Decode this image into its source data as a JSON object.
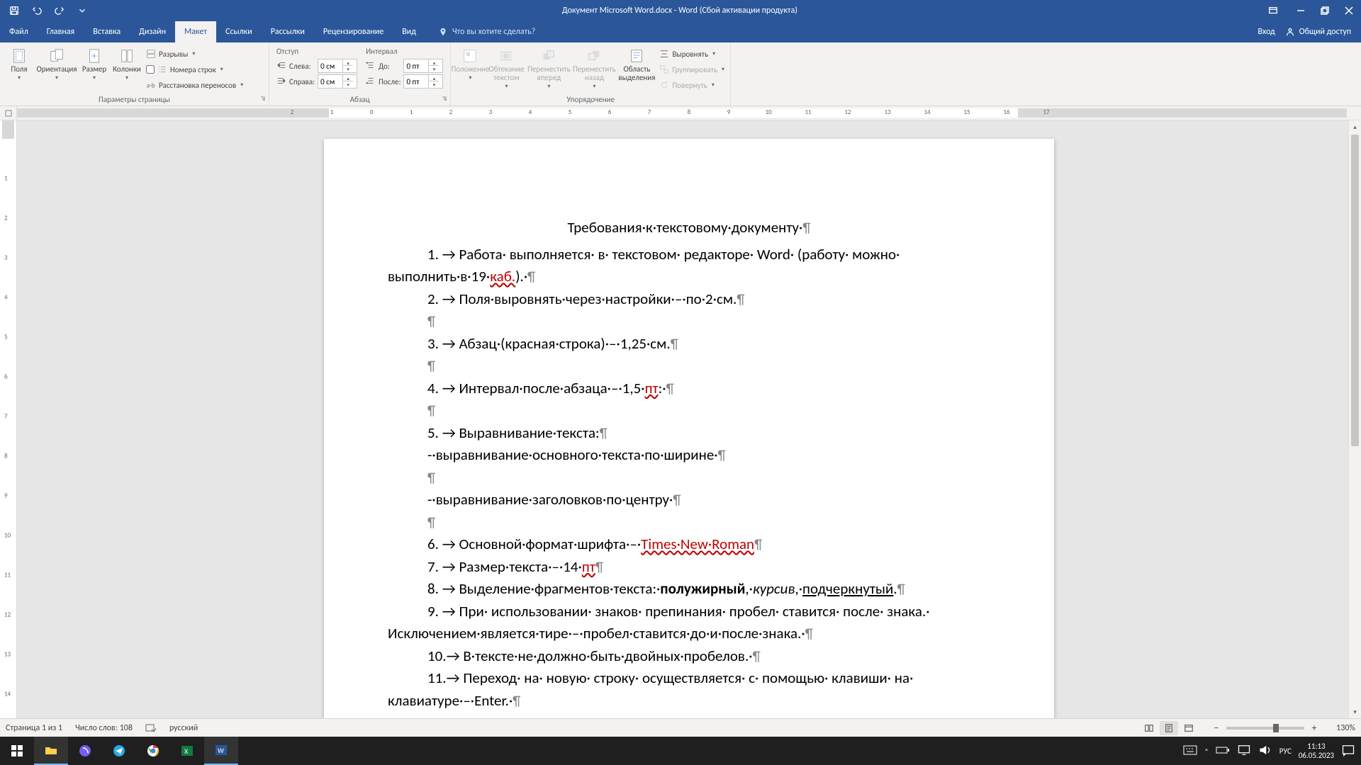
{
  "titlebar": {
    "title": "Документ Microsoft Word.docx - Word (Сбой активации продукта)"
  },
  "tabs": {
    "file": "Файл",
    "home": "Главная",
    "insert": "Вставка",
    "design": "Дизайн",
    "layout": "Макет",
    "references": "Ссылки",
    "mailings": "Рассылки",
    "review": "Рецензирование",
    "view": "Вид",
    "tell_me": "Что вы хотите сделать?",
    "signin": "Вход",
    "share": "Общий доступ"
  },
  "ribbon": {
    "page_setup": {
      "label": "Параметры страницы",
      "margins": "Поля",
      "orientation": "Ориентация",
      "size": "Размер",
      "columns": "Колонки",
      "breaks": "Разрывы",
      "line_numbers": "Номера строк",
      "hyphenation": "Расстановка переносов"
    },
    "paragraph": {
      "label": "Абзац",
      "indent_header": "Отступ",
      "left": "Слева:",
      "right": "Справа:",
      "left_val": "0 см",
      "right_val": "0 см",
      "spacing_header": "Интервал",
      "before": "До:",
      "after": "После:",
      "before_val": "0 пт",
      "after_val": "0 пт"
    },
    "arrange": {
      "label": "Упорядочение",
      "position": "Положение",
      "wrap": "Обтекание текстом",
      "forward": "Переместить вперед",
      "backward": "Переместить назад",
      "selection": "Область выделения",
      "align": "Выровнять",
      "group": "Группировать",
      "rotate": "Повернуть"
    }
  },
  "doc": {
    "title": "Требования·к·текстовому·документу·",
    "l1a": "1. → Работа· выполняется· в· текстовом· редакторе· Word· (работу· можно· ",
    "l1b": "выполнить·в·19·",
    "l1c": "каб.",
    "l1d": ").·",
    "l2": "2. → Поля·выровнять·через·настройки·–·по·2·см.",
    "l3": "3. → Абзац·(красная·строка)·–·1,25·см.",
    "l4a": "4. → Интервал·после·абзаца·–·1,5·",
    "l4b": "пт",
    "l4c": ":·",
    "l5": "5. → Выравнивание·текста:",
    "l5a": "-·выравнивание·основного·текста·по·ширине·",
    "l5b": "-·выравнивание·заголовков·по·центру·",
    "l6a": "6. → Основной·формат·шрифта·–·",
    "l6b": "Times·New·Roman",
    "l7a": "7. → Размер·текста·–·14·",
    "l7b": "пт",
    "l8a": "8. → Выделение·фрагментов·текста:·",
    "l8b": "полужирный",
    "l8c": ",·",
    "l8d": "курсив",
    "l8e": ",·",
    "l8f": "подчеркнутый",
    "l8g": ".",
    "l9a": "9. → При· использовании· знаков· препинания· пробел· ставится· после· знака.· ",
    "l9b": "Исключением·является·тире·–·пробел·ставится·до·и·после·знака.·",
    "l10": "10.→ В·тексте·не·должно·быть·двойных·пробелов.·",
    "l11a": "11.→ Переход· на· новую· строку· осуществляется· с· помощью· клавиши· на· ",
    "l11b": "клавиатуре·–·Enter.·"
  },
  "status": {
    "page": "Страница 1 из 1",
    "words": "Число слов: 108",
    "lang": "русский",
    "zoom": "130%"
  },
  "tray": {
    "lang": "РУС",
    "time": "11:13",
    "date": "06.05.2023"
  }
}
